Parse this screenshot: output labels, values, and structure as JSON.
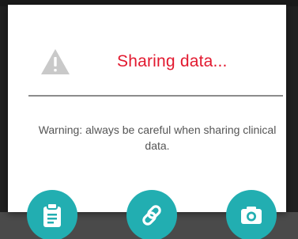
{
  "dialog": {
    "title": "Sharing data...",
    "message": "Warning: always be careful when sharing clinical data.",
    "icon": "warning-triangle-icon",
    "title_color": "#e2192f"
  },
  "actions": [
    {
      "name": "clipboard",
      "icon": "clipboard-icon"
    },
    {
      "name": "link",
      "icon": "link-icon"
    },
    {
      "name": "camera",
      "icon": "camera-icon"
    }
  ],
  "colors": {
    "accent": "#22aeb1",
    "warning_icon": "#c9c9c9",
    "divider": "#8c8c8c"
  }
}
